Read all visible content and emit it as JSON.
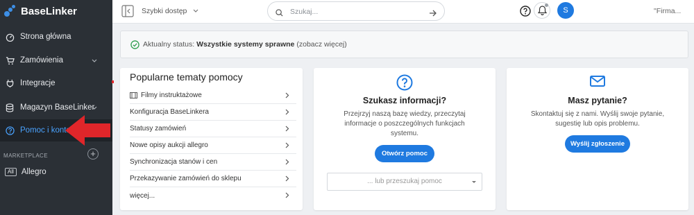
{
  "brand": {
    "name": "BaseLinker",
    "accent": "#1f7ae0",
    "sidebar_bg": "#2b3036"
  },
  "sidebar": {
    "items": [
      {
        "label": "Strona główna",
        "icon": "dashboard-icon"
      },
      {
        "label": "Zamówienia",
        "icon": "cart-icon",
        "expandable": true
      },
      {
        "label": "Integracje",
        "icon": "plug-icon"
      },
      {
        "label": "Magazyn BaseLinker",
        "icon": "database-icon",
        "expandable": true
      },
      {
        "label": "Pomoc i kontakt",
        "icon": "help-icon",
        "active": true
      }
    ],
    "marketplace_label": "MARKETPLACE",
    "marketplace_badge": "All",
    "marketplace_item": "Allegro"
  },
  "topbar": {
    "quick_access": "Szybki dostęp",
    "search_placeholder": "Szukaj...",
    "avatar_initial": "S",
    "company": "\"Firma..."
  },
  "status": {
    "prefix": "Aktualny status:",
    "value": "Wszystkie systemy sprawne",
    "link": "(zobacz więcej)"
  },
  "topics": {
    "title": "Popularne tematy pomocy",
    "items": [
      "Filmy instruktażowe",
      "Konfiguracja BaseLinkera",
      "Statusy zamówień",
      "Nowe opisy aukcji allegro",
      "Synchronizacja stanów i cen",
      "Przekazywanie zamówień do sklepu",
      "więcej..."
    ]
  },
  "info_card": {
    "title": "Szukasz informacji?",
    "desc": "Przejrzyj naszą bazę wiedzy, przeczytaj informacje o poszczególnych funkcjach systemu.",
    "button": "Otwórz pomoc",
    "select_placeholder": "... lub przeszukaj pomoc"
  },
  "ask_card": {
    "title": "Masz pytanie?",
    "desc": "Skontaktuj się z nami. Wyślij swoje pytanie, sugestię lub opis problemu.",
    "button": "Wyślij zgłoszenie"
  }
}
